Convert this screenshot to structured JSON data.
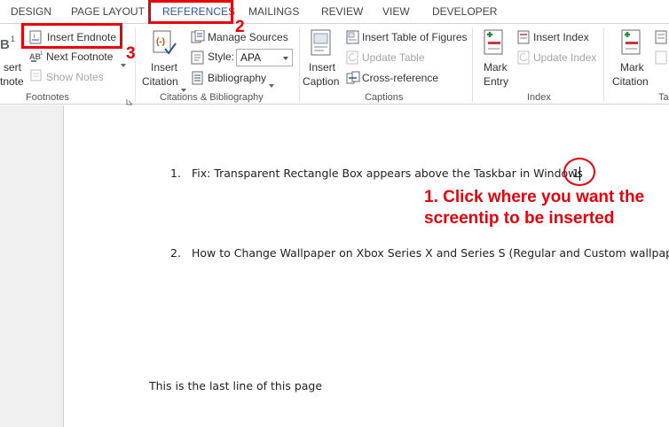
{
  "tabs": [
    "DESIGN",
    "PAGE LAYOUT",
    "REFERENCES",
    "MAILINGS",
    "REVIEW",
    "VIEW",
    "DEVELOPER"
  ],
  "ribbon": {
    "footnotes": {
      "insert_footnote_line1": "sert",
      "insert_footnote_line2": "tnote",
      "insert_endnote": "Insert Endnote",
      "next_footnote": "Next Footnote",
      "show_notes": "Show Notes",
      "group_label": "Footnotes"
    },
    "citations": {
      "insert_citation_line1": "Insert",
      "insert_citation_line2": "Citation",
      "manage_sources": "Manage Sources",
      "style_label": "Style:",
      "style_value": "APA",
      "bibliography": "Bibliography",
      "group_label": "Citations & Bibliography"
    },
    "captions": {
      "insert_caption_line1": "Insert",
      "insert_caption_line2": "Caption",
      "insert_table_of_figures": "Insert Table of Figures",
      "update_table": "Update Table",
      "cross_reference": "Cross-reference",
      "group_label": "Captions"
    },
    "index": {
      "mark_entry_line1": "Mark",
      "mark_entry_line2": "Entry",
      "insert_index": "Insert Index",
      "update_index": "Update Index",
      "group_label": "Index"
    },
    "toa": {
      "mark_citation_line1": "Mark",
      "mark_citation_line2": "Citation",
      "group_label_partial": "Ta"
    }
  },
  "document": {
    "item1_num": "1.",
    "item1_text": "Fix: Transparent Rectangle Box appears above the Taskbar in Windows",
    "item1_ref": "1",
    "item2_num": "2.",
    "item2_text": "How to Change Wallpaper on Xbox Series X and Series S (Regular and Custom wallpapers)",
    "last_line": "This is the last line of this page"
  },
  "annotations": {
    "step2": "2",
    "step3": "3",
    "step1_line1": "1. Click where you want the",
    "step1_line2": "screentip to be inserted",
    "color": "#e8000b"
  },
  "colors": {
    "accent": "#2b579a",
    "annotation": "#e8000b"
  }
}
